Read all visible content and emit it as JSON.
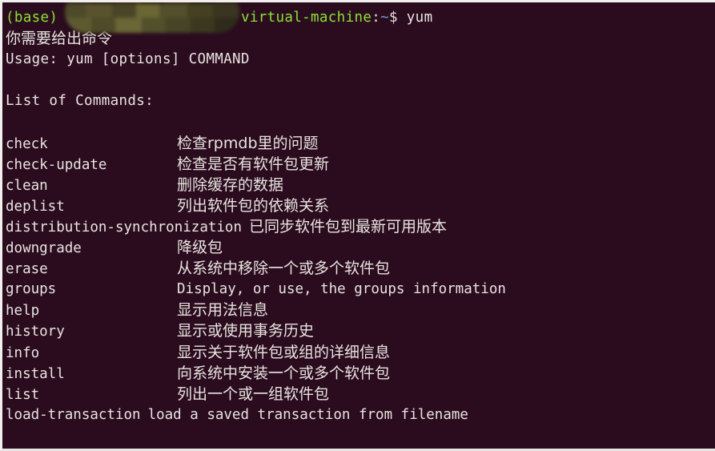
{
  "terminal": {
    "background_color": "#2B0C1F",
    "foreground_color": "#e8e4df",
    "prompt_color": "#8AE234",
    "tilde_color": "#729FCF",
    "prompt": {
      "conda_env": "(base)",
      "username_redacted": "",
      "host_suffix": "virtual-machine",
      "separator": ":",
      "path": "~",
      "sigil": "$",
      "command": "yum"
    },
    "output": {
      "error_line": "你需要给出命令",
      "usage_line": "Usage: yum [options] COMMAND",
      "list_header": "List of Commands:"
    },
    "commands": [
      {
        "name": "check",
        "description": "检查rpmdb里的问题",
        "aligned": true
      },
      {
        "name": "check-update",
        "description": "检查是否有软件包更新",
        "aligned": true
      },
      {
        "name": "clean",
        "description": "删除缓存的数据",
        "aligned": true
      },
      {
        "name": "deplist",
        "description": "列出软件包的依赖关系",
        "aligned": true
      },
      {
        "name": "distribution-synchronization",
        "description": "已同步软件包到最新可用版本",
        "aligned": false
      },
      {
        "name": "downgrade",
        "description": "降级包",
        "aligned": true
      },
      {
        "name": "erase",
        "description": "从系统中移除一个或多个软件包",
        "aligned": true
      },
      {
        "name": "groups",
        "description": "Display, or use, the groups information",
        "aligned": true
      },
      {
        "name": "help",
        "description": "显示用法信息",
        "aligned": true
      },
      {
        "name": "history",
        "description": "显示或使用事务历史",
        "aligned": true
      },
      {
        "name": "info",
        "description": "显示关于软件包或组的详细信息",
        "aligned": true
      },
      {
        "name": "install",
        "description": "向系统中安装一个或多个软件包",
        "aligned": true
      },
      {
        "name": "list",
        "description": "列出一个或一组软件包",
        "aligned": true
      },
      {
        "name": "load-transaction",
        "description": "load a saved transaction from filename",
        "aligned": false
      }
    ]
  }
}
